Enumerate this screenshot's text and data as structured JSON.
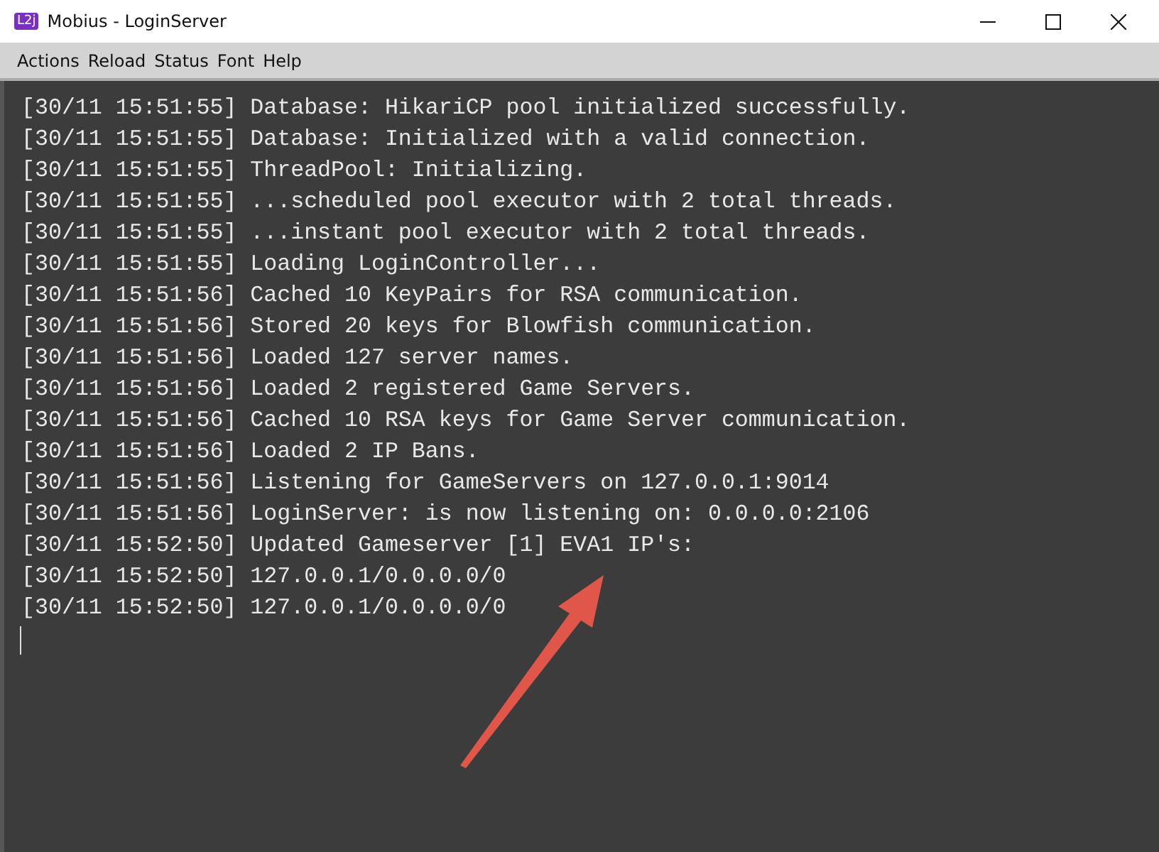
{
  "window": {
    "title": "Mobius - LoginServer",
    "app_badge": "L2j"
  },
  "menu": [
    "Actions",
    "Reload",
    "Status",
    "Font",
    "Help"
  ],
  "console": {
    "lines": [
      "[30/11 15:51:55] Database: HikariCP pool initialized successfully.",
      "[30/11 15:51:55] Database: Initialized with a valid connection.",
      "[30/11 15:51:55] ThreadPool: Initializing.",
      "[30/11 15:51:55] ...scheduled pool executor with 2 total threads.",
      "[30/11 15:51:55] ...instant pool executor with 2 total threads.",
      "[30/11 15:51:55] Loading LoginController...",
      "[30/11 15:51:56] Cached 10 KeyPairs for RSA communication.",
      "[30/11 15:51:56] Stored 20 keys for Blowfish communication.",
      "[30/11 15:51:56] Loaded 127 server names.",
      "[30/11 15:51:56] Loaded 2 registered Game Servers.",
      "[30/11 15:51:56] Cached 10 RSA keys for Game Server communication.",
      "[30/11 15:51:56] Loaded 2 IP Bans.",
      "[30/11 15:51:56] Listening for GameServers on 127.0.0.1:9014",
      "[30/11 15:51:56] LoginServer: is now listening on: 0.0.0.0:2106",
      "[30/11 15:52:50] Updated Gameserver [1] EVA1 IP's:",
      "[30/11 15:52:50] 127.0.0.1/0.0.0.0/0",
      "[30/11 15:52:50] 127.0.0.1/0.0.0.0/0"
    ]
  }
}
